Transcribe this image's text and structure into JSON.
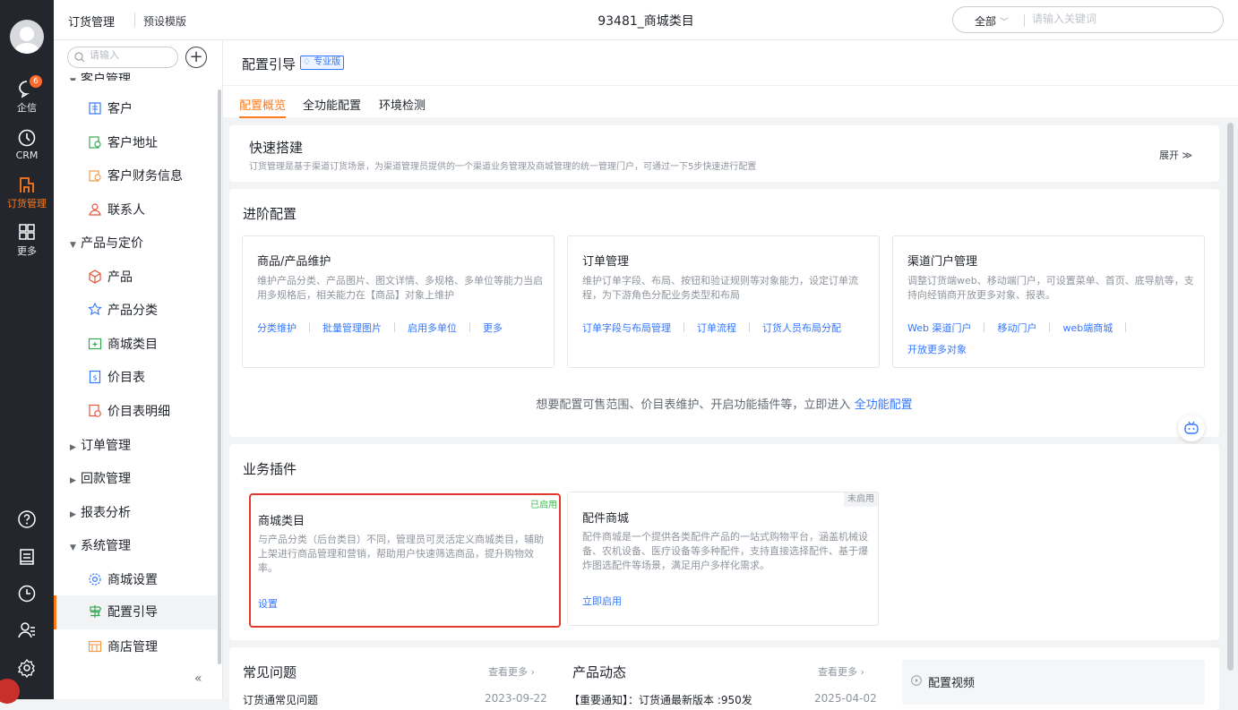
{
  "rail": {
    "items": [
      {
        "label": "企信",
        "icon": "chat-bubble-icon",
        "badge": "6"
      },
      {
        "label": "CRM",
        "icon": "clock-icon"
      },
      {
        "label": "订货管理",
        "icon": "order-icon",
        "active": true
      },
      {
        "label": "更多",
        "icon": "grid-icon"
      }
    ],
    "bottom_icons": [
      "help-icon",
      "note-icon",
      "history-icon",
      "contacts-icon",
      "settings-icon"
    ]
  },
  "topbar": {
    "tab1": "订货管理",
    "tab2": "预设模版",
    "title": "93481_商城类目",
    "search_scope": "全部",
    "search_placeholder": "请输入关键词"
  },
  "sidebar": {
    "search_placeholder": "请输入",
    "cut_group": "客户管理",
    "customer_items": [
      "客户",
      "客户地址",
      "客户财务信息",
      "联系人"
    ],
    "group_product": "产品与定价",
    "product_items": [
      "产品",
      "产品分类",
      "商城类目",
      "价目表",
      "价目表明细"
    ],
    "group_order": "订单管理",
    "group_payment": "回款管理",
    "group_report": "报表分析",
    "group_system": "系统管理",
    "system_items": [
      "商城设置",
      "配置引导",
      "商店管理"
    ],
    "active_item": "配置引导",
    "collapse": "«"
  },
  "main": {
    "title": "配置引导",
    "pro_tag": "专业版",
    "tabs": [
      "配置概览",
      "全功能配置",
      "环境检测"
    ],
    "active_tab": "配置概览",
    "quick": {
      "title": "快速搭建",
      "desc": "订货管理是基于渠道订货场景，为渠道管理员提供的一个渠道业务管理及商城管理的统一管理门户，可通过一下5步快速进行配置",
      "expand": "展开 ≫"
    },
    "advanced": {
      "title": "进阶配置",
      "cards": [
        {
          "name": "商品/产品维护",
          "desc": "维护产品分类、产品图片、图文详情、多规格、多单位等能力当启用多规格后，相关能力在【商品】对象上维护",
          "links": [
            "分类维护",
            "批量管理图片",
            "启用多单位",
            "更多"
          ]
        },
        {
          "name": "订单管理",
          "desc": "维护订单字段、布局、按钮和验证规则等对象能力，设定订单流程，为下游角色分配业务类型和布局",
          "links": [
            "订单字段与布局管理",
            "订单流程",
            "订货人员布局分配"
          ]
        },
        {
          "name": "渠道门户管理",
          "desc": "调整订货端web、移动端门户，可设置菜单、首页、底导航等，支持向经销商开放更多对象、报表。",
          "links": [
            "Web 渠道门户",
            "移动门户",
            "web端商城",
            "开放更多对象"
          ]
        }
      ],
      "tip_text": "想要配置可售范围、价目表维护、开启功能插件等，立即进入 ",
      "tip_link": "全功能配置"
    },
    "plugins": {
      "title": "业务插件",
      "cards": [
        {
          "name": "商城类目",
          "status": "已启用",
          "desc": "与产品分类（后台类目）不同，管理员可灵活定义商城类目，辅助上架进行商品管理和营销，帮助用户快速筛选商品，提升购物效率。",
          "link": "设置"
        },
        {
          "name": "配件商城",
          "status": "未启用",
          "desc": "配件商城是一个提供各类配件产品的一站式购物平台，涵盖机械设备、农机设备、医疗设备等多种配件，支持直接选择配件、基于爆炸图选配件等场景，满足用户多样化需求。",
          "link": "立即启用"
        }
      ]
    },
    "bottom": {
      "faq_title": "常见问题",
      "faq_more": "查看更多 ›",
      "faq_item": "订货通常见问题",
      "faq_date": "2023-09-22",
      "news_title": "产品动态",
      "news_more": "查看更多 ›",
      "news_item": "【重要通知】：订货通最新版本 :950发",
      "news_date": "2025-04-02",
      "video_label": "配置视频"
    }
  },
  "colors": {
    "accent": "#ff7a1a",
    "link": "#3377ff",
    "highlight": "#e23b2e",
    "enabled": "#35c24a"
  }
}
